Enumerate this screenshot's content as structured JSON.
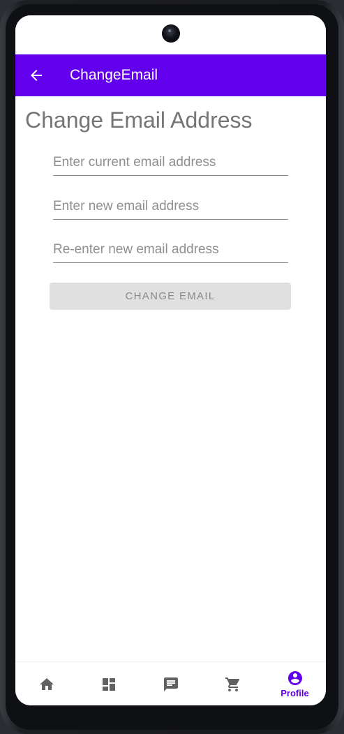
{
  "app_bar": {
    "title": "ChangeEmail",
    "back_icon": "arrow-back-icon",
    "color": "#6200ee"
  },
  "page": {
    "heading": "Change Email Address"
  },
  "form": {
    "current_email_placeholder": "Enter current email address",
    "current_email_value": "",
    "new_email_placeholder": "Enter new email address",
    "new_email_value": "",
    "confirm_email_placeholder": "Re-enter new email address",
    "confirm_email_value": "",
    "submit_label": "CHANGE EMAIL",
    "submit_state": "disabled"
  },
  "bottom_nav": {
    "items": [
      {
        "icon": "home-icon",
        "label": "",
        "active": false
      },
      {
        "icon": "dashboard-icon",
        "label": "",
        "active": false
      },
      {
        "icon": "message-icon",
        "label": "",
        "active": false
      },
      {
        "icon": "cart-icon",
        "label": "",
        "active": false
      },
      {
        "icon": "profile-icon",
        "label": "Profile",
        "active": true
      }
    ],
    "active_color": "#6200ee",
    "inactive_color": "#616161"
  }
}
